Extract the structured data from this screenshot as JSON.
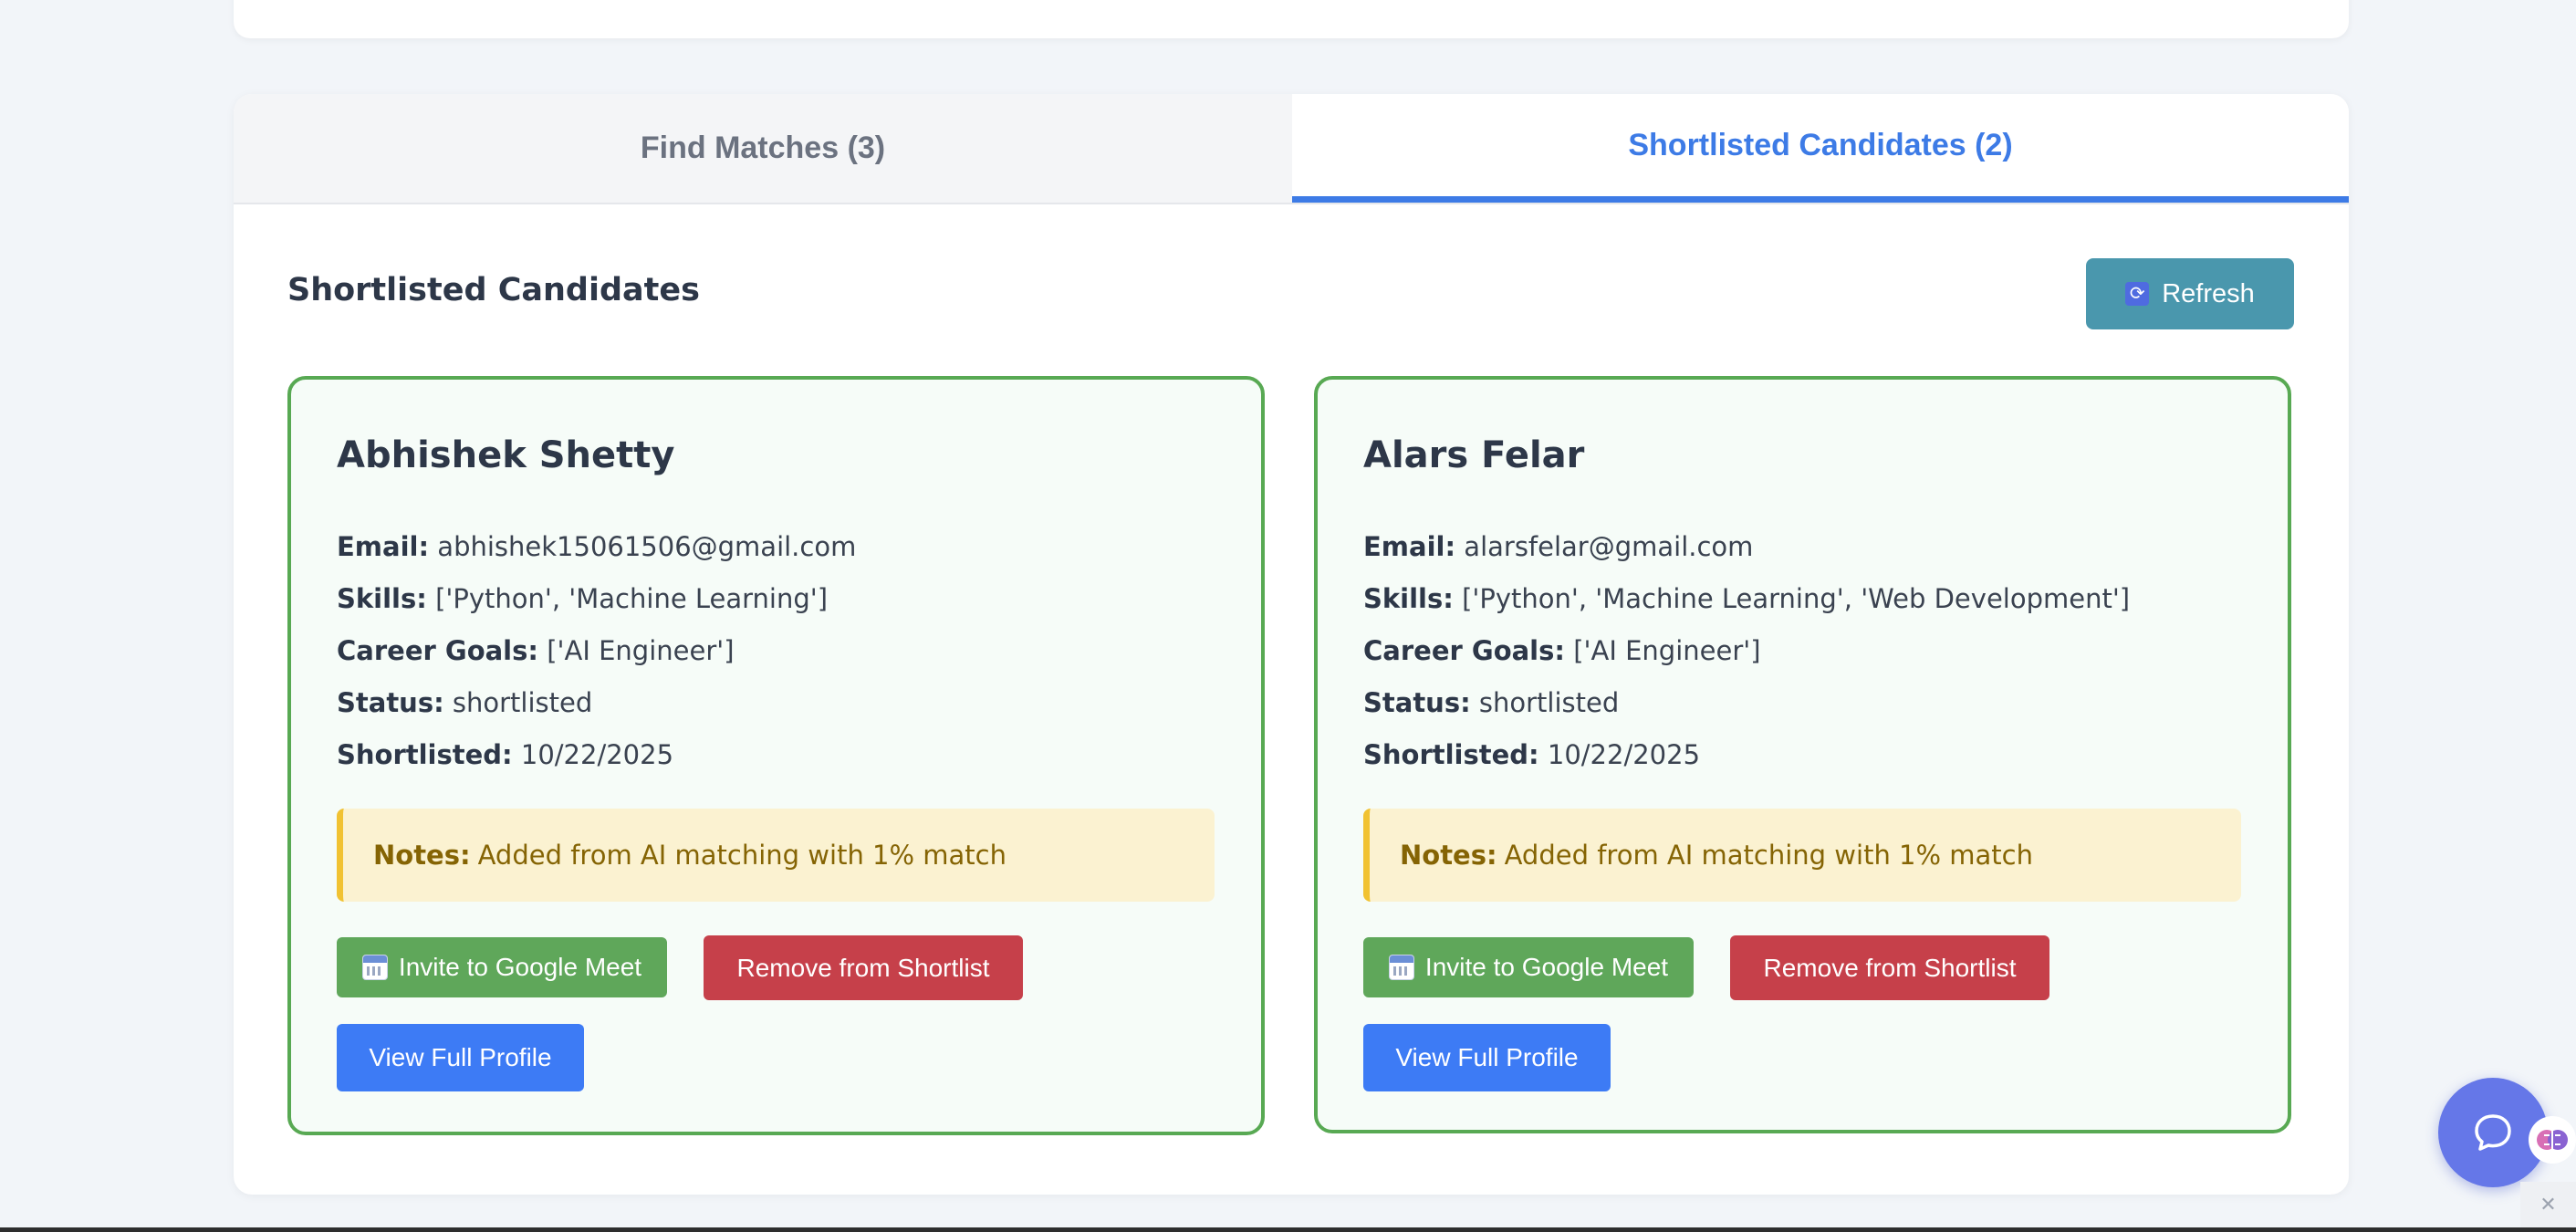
{
  "tabs": {
    "find_matches": "Find Matches (3)",
    "shortlisted": "Shortlisted Candidates (2)"
  },
  "section": {
    "title": "Shortlisted Candidates",
    "refresh_label": "Refresh",
    "refresh_icon": "refresh-icon"
  },
  "labels": {
    "email": "Email:",
    "skills": "Skills:",
    "career_goals": "Career Goals:",
    "status": "Status:",
    "shortlisted": "Shortlisted:",
    "notes": "Notes:"
  },
  "candidates": [
    {
      "name": "Abhishek Shetty",
      "email": "abhishek15061506@gmail.com",
      "skills": "['Python', 'Machine Learning']",
      "career_goals": "['AI Engineer']",
      "status": "shortlisted",
      "shortlisted_date": "10/22/2025",
      "notes": "Added from AI matching with 1% match",
      "meet_label": "Invite to Google Meet",
      "remove_label": "Remove from Shortlist",
      "view_label": "View Full Profile"
    },
    {
      "name": "Alars Felar",
      "email": "alarsfelar@gmail.com",
      "skills": "['Python', 'Machine Learning', 'Web Development']",
      "career_goals": "['AI Engineer']",
      "status": "shortlisted",
      "shortlisted_date": "10/22/2025",
      "notes": "Added from AI matching with 1% match",
      "meet_label": "Invite to Google Meet",
      "remove_label": "Remove from Shortlist",
      "view_label": "View Full Profile"
    }
  ],
  "colors": {
    "accent": "#3d7be6",
    "card_border": "#58a953",
    "refresh_bg": "#4a97ad",
    "meet_bg": "#5fa75a",
    "remove_bg": "#c6404a",
    "view_bg": "#3d7bf5",
    "notes_bg": "#fbf2d1",
    "chat_bg": "#6577e8"
  },
  "icons": {
    "meet": "calendar-icon",
    "chat": "chat-icon",
    "assistant": "brain-icon"
  }
}
